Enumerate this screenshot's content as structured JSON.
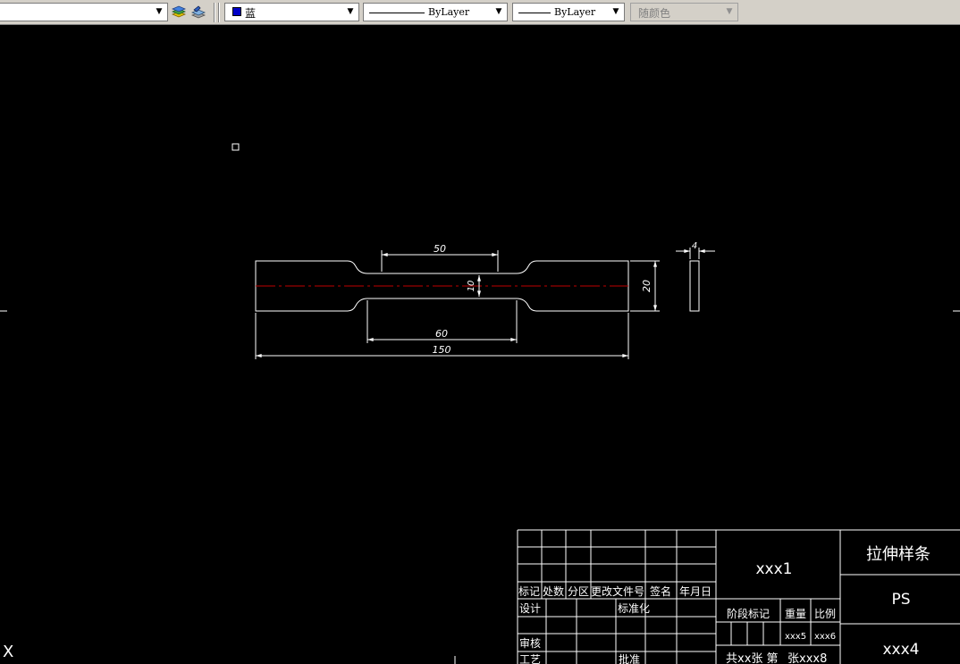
{
  "toolbar": {
    "layer_combo_value": "",
    "color_combo": {
      "label": "蓝",
      "swatch": "#0000c8"
    },
    "linetype_combo": {
      "label": "ByLayer"
    },
    "lineweight_combo": {
      "label": "ByLayer"
    },
    "plotstyle_combo": {
      "label": "随颜色"
    }
  },
  "drawing": {
    "dimensions": {
      "gauge_length": "50",
      "narrow_width": "10",
      "parallel_length": "60",
      "total_length": "150",
      "end_width": "20",
      "thickness": "4"
    },
    "ucs_axis_label": "X"
  },
  "title_block": {
    "headers": {
      "mark": "标记",
      "count": "处数",
      "zone": "分区",
      "change_doc": "更改文件号",
      "signature": "签名",
      "date": "年月日"
    },
    "roles": {
      "design": "设计",
      "standardization": "标准化",
      "review": "审核",
      "process": "工艺",
      "approve": "批准"
    },
    "drawing_code": "xxx1",
    "part_name": "拉伸样条",
    "material": "PS",
    "company": "xxx4",
    "stage_mark": "阶段标记",
    "weight_label": "重量",
    "scale_label": "比例",
    "weight_value": "xxx5",
    "scale_value": "xxx6",
    "sheet_info": "共xx张 第",
    "sheet_no": "张xxx8"
  },
  "colors": {
    "canvas": "#000000",
    "lines": "#ffffff",
    "centerline": "#c00000"
  }
}
